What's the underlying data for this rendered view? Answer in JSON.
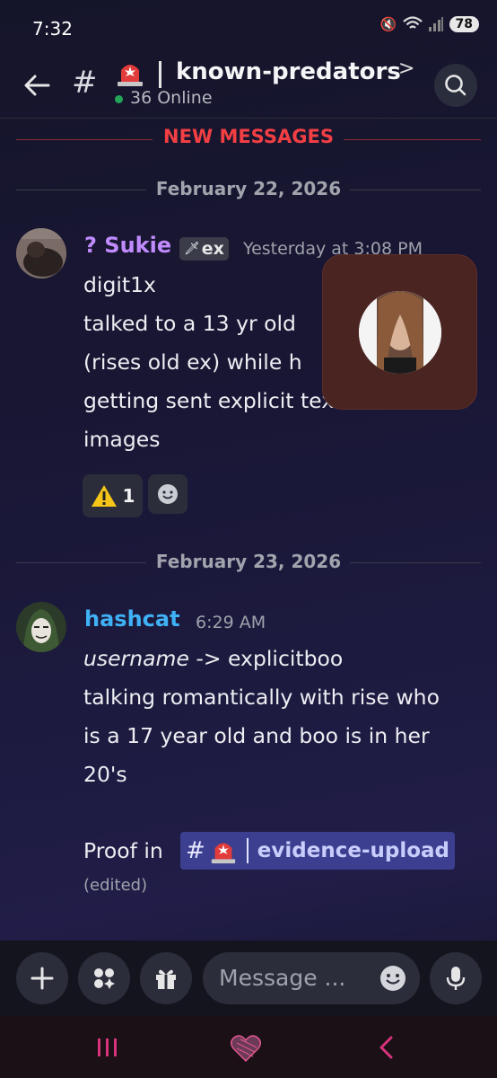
{
  "status": {
    "time": "7:32",
    "battery": "78"
  },
  "header": {
    "hash": "#",
    "channel": "known-predators",
    "chevron": ">",
    "online": "36 Online"
  },
  "separators": {
    "new_messages": "NEW MESSAGES",
    "date1": "February 22, 2026",
    "date2": "February 23, 2026"
  },
  "message1": {
    "author": "? Sukie",
    "tag": "ex",
    "timestamp": "Yesterday at 3:08 PM",
    "lines": [
      "digit1x",
      "talked to a 13 yr old",
      "(rises old ex) while h",
      "getting sent explicit texts and",
      "images"
    ],
    "reaction_count": "1"
  },
  "message2": {
    "author": "hashcat",
    "timestamp": "6:29 AM",
    "line1_italic": "username",
    "line1_rest": " -> explicitboo",
    "lines": [
      "talking romantically with rise who",
      "is a 17 year old and boo is in her",
      "20's"
    ],
    "proof": "Proof in",
    "mention_hash": "#",
    "mention_channel": "evidence-upload",
    "edited": "(edited)"
  },
  "composer": {
    "placeholder": "Message ..."
  },
  "colors": {
    "accent_red": "#f23f43",
    "hashcat": "#3fb1f5",
    "sukie": "#c08bff",
    "online": "#23a55a",
    "mention_bg": "#3c3f8f"
  },
  "icons": [
    "back-arrow-icon",
    "siren-icon",
    "search-icon",
    "warning-icon",
    "emoji-icon",
    "plus-icon",
    "apps-icon",
    "gift-icon",
    "microphone-icon",
    "nav-recents-icon",
    "nav-home-icon",
    "nav-back-icon"
  ]
}
